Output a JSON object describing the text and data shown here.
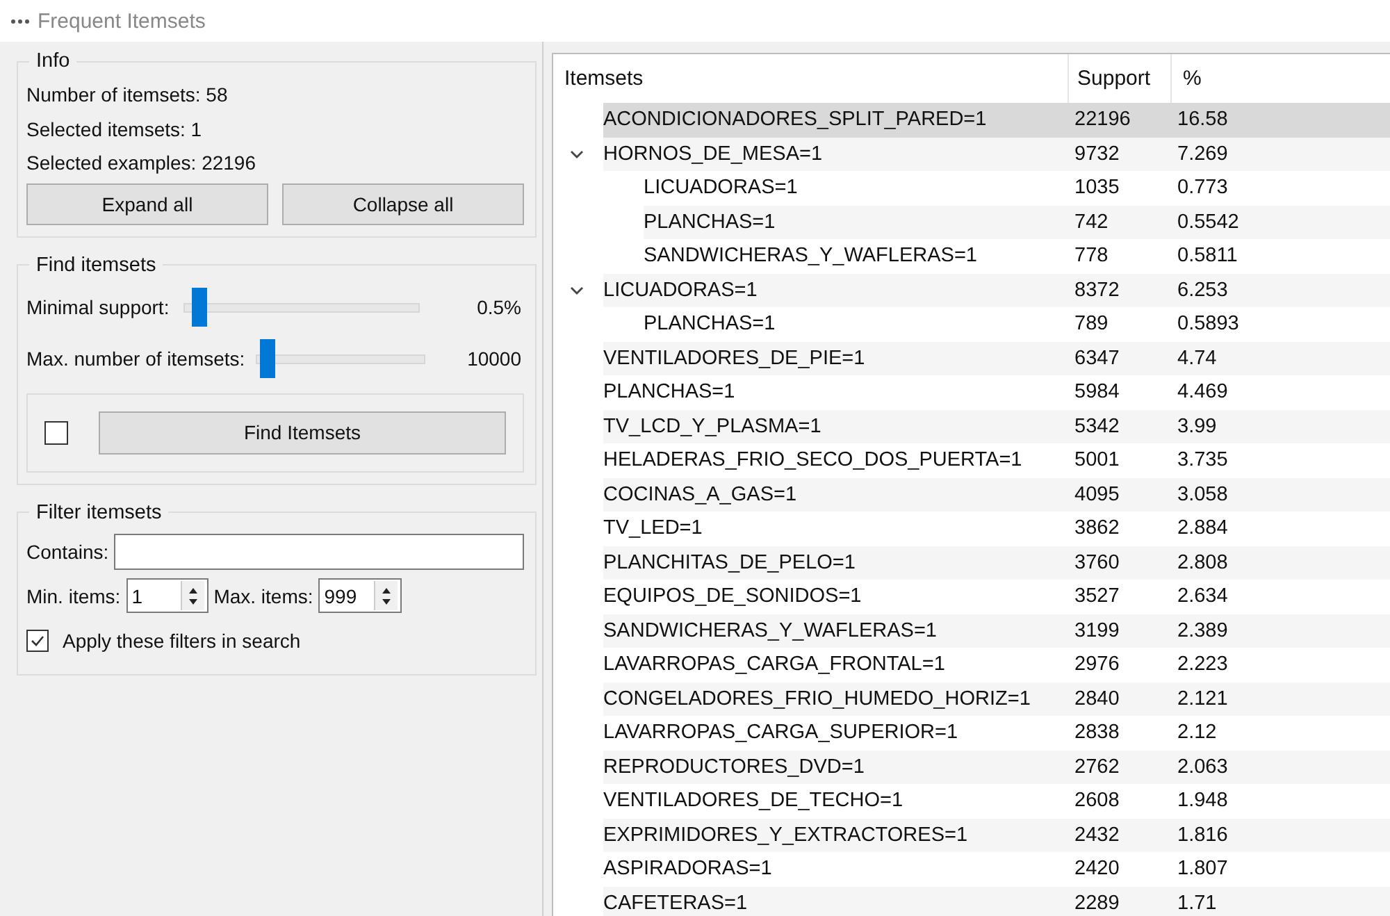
{
  "window": {
    "title": "Frequent Itemsets"
  },
  "info": {
    "title": "Info",
    "lines": [
      "Number of itemsets: 58",
      "Selected itemsets: 1",
      "Selected examples: 22196"
    ],
    "buttons": [
      "Expand all",
      "Collapse all"
    ]
  },
  "find": {
    "title": "Find itemsets",
    "sliders": [
      {
        "label": "Minimal support:",
        "level": 0.06,
        "reading": "0.5%"
      },
      {
        "label": "Max. number of itemsets:",
        "level": 0.06,
        "reading": "10000"
      }
    ],
    "auto_find": {
      "checked": false
    },
    "button": "Find Itemsets"
  },
  "filter": {
    "title": "Filter itemsets",
    "contains": {
      "label": "Contains:"
    },
    "min_items": {
      "label": "Min. items:",
      "value": "1"
    },
    "max_items": {
      "label": "Max. items:",
      "value": "999"
    },
    "apply": {
      "label": "Apply these filters in search",
      "checked": true
    }
  },
  "table": {
    "columns": [
      "Itemsets",
      "Support",
      "%"
    ],
    "rows": [
      {
        "itemset": "ACONDICIONADORES_SPLIT_PARED=1",
        "support": "22196",
        "percent": "16.58",
        "selected": true
      },
      {
        "itemset": "HORNOS_DE_MESA=1",
        "support": "9732",
        "percent": "7.269",
        "selected": false,
        "expanded": true,
        "children": [
          {
            "itemset": "LICUADORAS=1",
            "support": "1035",
            "percent": "0.773",
            "selected": false
          },
          {
            "itemset": "PLANCHAS=1",
            "support": "742",
            "percent": "0.5542",
            "selected": false
          },
          {
            "itemset": "SANDWICHERAS_Y_WAFLERAS=1",
            "support": "778",
            "percent": "0.5811",
            "selected": false
          }
        ]
      },
      {
        "itemset": "LICUADORAS=1",
        "support": "8372",
        "percent": "6.253",
        "selected": false,
        "expanded": true,
        "children": [
          {
            "itemset": "PLANCHAS=1",
            "support": "789",
            "percent": "0.5893",
            "selected": false
          }
        ]
      },
      {
        "itemset": "VENTILADORES_DE_PIE=1",
        "support": "6347",
        "percent": "4.74",
        "selected": false
      },
      {
        "itemset": "PLANCHAS=1",
        "support": "5984",
        "percent": "4.469",
        "selected": false
      },
      {
        "itemset": "TV_LCD_Y_PLASMA=1",
        "support": "5342",
        "percent": "3.99",
        "selected": false
      },
      {
        "itemset": "HELADERAS_FRIO_SECO_DOS_PUERTA=1",
        "support": "5001",
        "percent": "3.735",
        "selected": false
      },
      {
        "itemset": "COCINAS_A_GAS=1",
        "support": "4095",
        "percent": "3.058",
        "selected": false
      },
      {
        "itemset": "TV_LED=1",
        "support": "3862",
        "percent": "2.884",
        "selected": false
      },
      {
        "itemset": "PLANCHITAS_DE_PELO=1",
        "support": "3760",
        "percent": "2.808",
        "selected": false
      },
      {
        "itemset": "EQUIPOS_DE_SONIDOS=1",
        "support": "3527",
        "percent": "2.634",
        "selected": false
      },
      {
        "itemset": "SANDWICHERAS_Y_WAFLERAS=1",
        "support": "3199",
        "percent": "2.389",
        "selected": false
      },
      {
        "itemset": "LAVARROPAS_CARGA_FRONTAL=1",
        "support": "2976",
        "percent": "2.223",
        "selected": false
      },
      {
        "itemset": "CONGELADORES_FRIO_HUMEDO_HORIZ=1",
        "support": "2840",
        "percent": "2.121",
        "selected": false
      },
      {
        "itemset": "LAVARROPAS_CARGA_SUPERIOR=1",
        "support": "2838",
        "percent": "2.12",
        "selected": false
      },
      {
        "itemset": "REPRODUCTORES_DVD=1",
        "support": "2762",
        "percent": "2.063",
        "selected": false
      },
      {
        "itemset": "VENTILADORES_DE_TECHO=1",
        "support": "2608",
        "percent": "1.948",
        "selected": false
      },
      {
        "itemset": "EXPRIMIDORES_Y_EXTRACTORES=1",
        "support": "2432",
        "percent": "1.816",
        "selected": false
      },
      {
        "itemset": "ASPIRADORAS=1",
        "support": "2420",
        "percent": "1.807",
        "selected": false
      },
      {
        "itemset": "CAFETERAS=1",
        "support": "2289",
        "percent": "1.71",
        "selected": false
      }
    ]
  }
}
